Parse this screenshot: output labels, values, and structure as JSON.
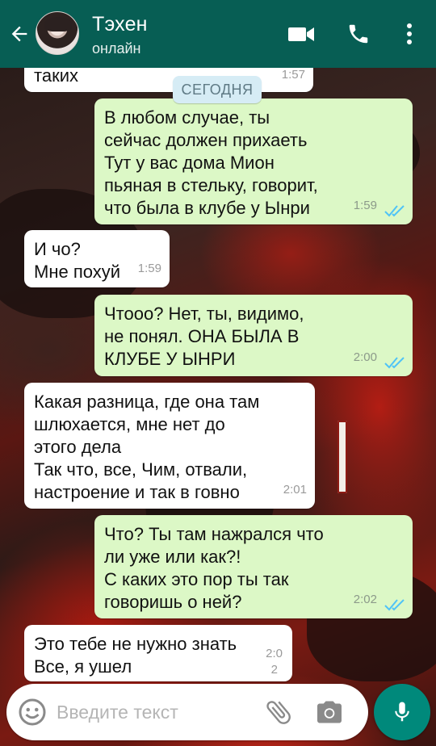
{
  "header": {
    "contact_name": "Тэхен",
    "status": "онлайн"
  },
  "date_divider": "СЕГОДНЯ",
  "messages": [
    {
      "dir": "in",
      "text": "таких",
      "time": "1:57"
    },
    {
      "dir": "out",
      "text": "В любом случае, ты\nсейчас должен прихаеть\nТут у вас дома Мион\nпьяная в стельку, говорит,\nчто была в клубе у Ынри",
      "time": "1:59",
      "read": true
    },
    {
      "dir": "in",
      "text": "И чо?\nМне похуй",
      "time": "1:59"
    },
    {
      "dir": "out",
      "text": "Чтооо? Нет, ты, видимо,\nне понял. ОНА БЫЛА В\nКЛУБЕ У ЫНРИ",
      "time": "2:00",
      "read": true
    },
    {
      "dir": "in",
      "text": "Какая разница, где она там\nшлюхается, мне нет до\nэтого дела\nТак что, все, Чим, отвали,\nнастроение и так в говно",
      "time": "2:01"
    },
    {
      "dir": "out",
      "text": "Что? Ты там нажрался что\nли уже или как?!\nС каких это пор ты так\nговоришь о ней?",
      "time": "2:02",
      "read": true
    },
    {
      "dir": "in",
      "text": "Это тебе не нужно знать\nВсе, я ушел",
      "time_line1": "2:0",
      "time_line2": "2"
    }
  ],
  "composer": {
    "placeholder": "Введите текст"
  },
  "colors": {
    "header": "#075e54",
    "outgoing_bubble": "#dcf8c6",
    "incoming_bubble": "#ffffff",
    "read_ticks": "#4fc3f7",
    "mic_button": "#00897b"
  },
  "icons": [
    "back-arrow-icon",
    "video-call-icon",
    "phone-icon",
    "more-vert-icon",
    "emoji-icon",
    "attach-clip-icon",
    "camera-icon",
    "mic-icon",
    "double-check-icon"
  ]
}
